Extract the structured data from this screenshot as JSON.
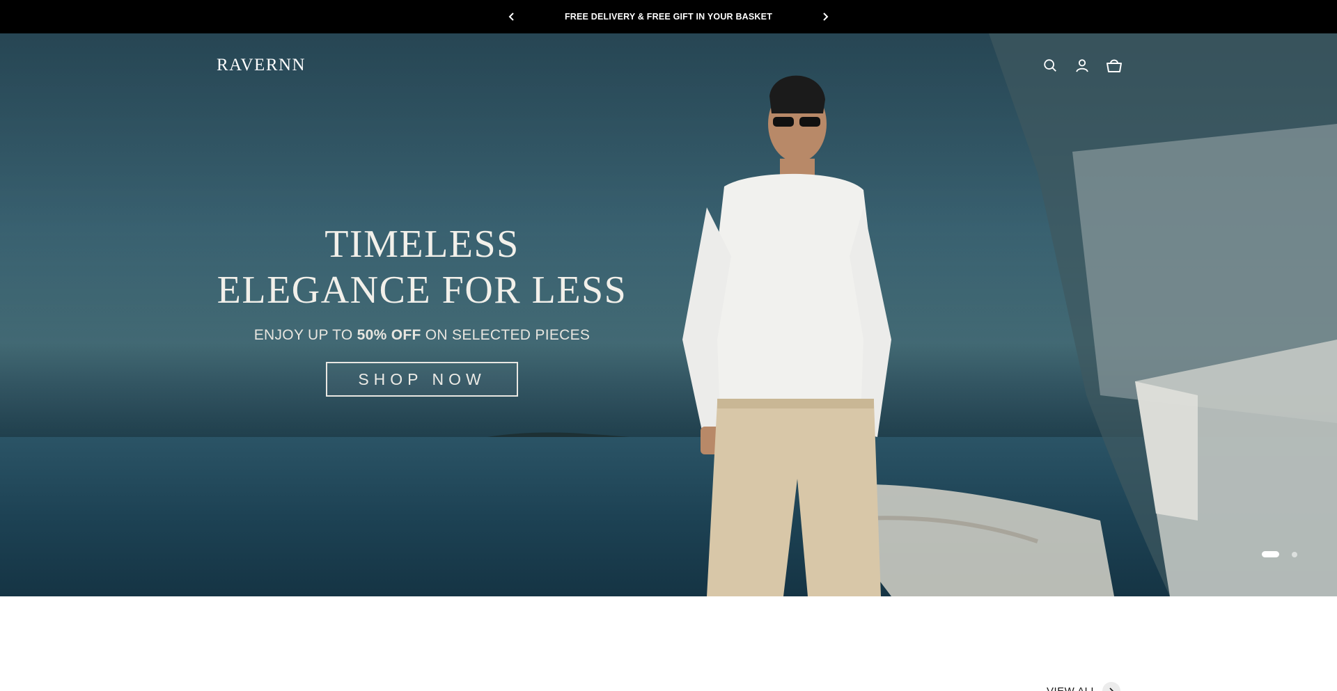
{
  "announcement": {
    "text": "FREE DELIVERY & FREE GIFT IN YOUR BASKET",
    "prev_icon": "chevron-left-icon",
    "next_icon": "chevron-right-icon"
  },
  "header": {
    "logo": "RAVERNN",
    "icons": [
      "search-icon",
      "account-icon",
      "basket-icon"
    ]
  },
  "hero": {
    "title_line1": "TIMELESS",
    "title_line2": "ELEGANCE FOR LESS",
    "subtitle_pre": "ENJOY UP TO ",
    "subtitle_bold": "50% OFF",
    "subtitle_post": " ON SELECTED PIECES",
    "cta_label": "SHOP NOW",
    "slides_total": 2,
    "active_slide": 1
  },
  "section": {
    "view_all_label": "VIEW ALL"
  },
  "colors": {
    "announcement_bg": "#000000",
    "hero_sea": "#2b5466",
    "text_light": "#ffffff"
  }
}
